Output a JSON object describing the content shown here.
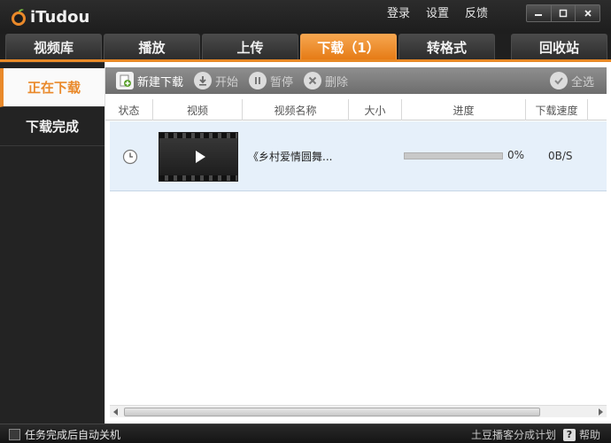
{
  "app": {
    "logo_text": "iTudou",
    "brand_color": "#e9892a"
  },
  "top_links": [
    "登录",
    "设置",
    "反馈"
  ],
  "tabs": [
    {
      "label": "视频库",
      "active": false
    },
    {
      "label": "播放",
      "active": false
    },
    {
      "label": "上传",
      "active": false
    },
    {
      "label": "下载（1）",
      "active": true
    },
    {
      "label": "转格式",
      "active": false
    },
    {
      "label": "回收站",
      "active": false
    }
  ],
  "sidebar": {
    "items": [
      {
        "label": "正在下载",
        "active": true
      },
      {
        "label": "下载完成",
        "active": false
      }
    ]
  },
  "toolbar": {
    "new_download": "新建下载",
    "start": "开始",
    "pause": "暂停",
    "delete": "删除",
    "select_all": "全选"
  },
  "columns": [
    "状态",
    "视频",
    "视频名称",
    "大小",
    "进度",
    "下载速度"
  ],
  "downloads": [
    {
      "status_icon": "clock-icon",
      "title": "《乡村爱情圆舞...",
      "size": "",
      "progress": 0,
      "progress_text": "0%",
      "speed": "0B/S"
    }
  ],
  "statusbar": {
    "auto_shutdown": "任务完成后自动关机",
    "promo": "土豆播客分成计划",
    "help_icon": "?",
    "help": "帮助"
  }
}
